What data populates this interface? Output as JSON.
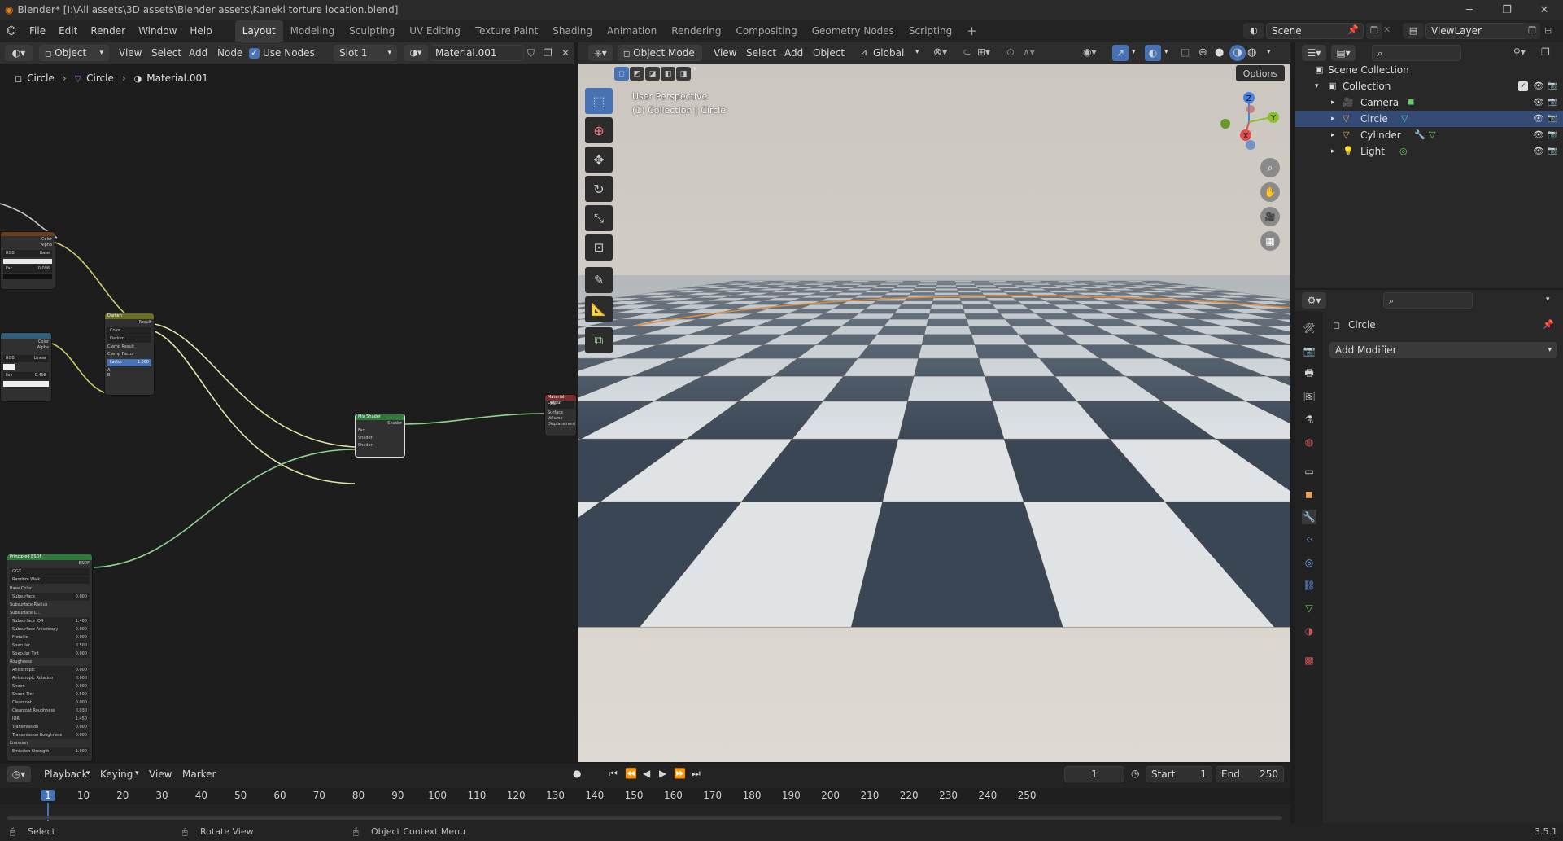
{
  "window": {
    "title": "Blender* [I:\\All assets\\3D assets\\Blender assets\\Kaneki torture location.blend]",
    "minimize": "─",
    "maximize": "❐",
    "close": "✕"
  },
  "menubar": {
    "items": [
      "File",
      "Edit",
      "Render",
      "Window",
      "Help"
    ],
    "workspaces": [
      "Layout",
      "Modeling",
      "Sculpting",
      "UV Editing",
      "Texture Paint",
      "Shading",
      "Animation",
      "Rendering",
      "Compositing",
      "Geometry Nodes",
      "Scripting"
    ],
    "active_workspace": "Layout",
    "add_workspace": "+",
    "scene": "Scene",
    "view_layer": "ViewLayer"
  },
  "node_editor": {
    "object_selector": "Object",
    "menus": [
      "View",
      "Select",
      "Add",
      "Node"
    ],
    "use_nodes_label": "Use Nodes",
    "slot": "Slot 1",
    "material": "Material.001",
    "breadcrumb": [
      "Circle",
      "Circle",
      "Material.001"
    ],
    "nodes": {
      "image1": {
        "color_out": "Color",
        "alpha_out": "Alpha",
        "mode1": "RGB",
        "mode2": "Base",
        "field1": "Fac",
        "field1_val": "0.098"
      },
      "image2": {
        "color_out": "Color",
        "alpha_out": "Alpha",
        "mode1": "RGB",
        "mode2": "Linear",
        "field1": "Fac",
        "field1_val": "0.498"
      },
      "darken": {
        "title": "Darken",
        "out": "Result",
        "opt1": "Color",
        "opt2": "Darken",
        "clamp1": "Clamp Result",
        "clamp2": "Clamp Factor",
        "factor": "Factor",
        "factor_val": "1.000",
        "in_a": "A",
        "in_b": "B"
      },
      "mix_shader": {
        "title": "Mix Shader",
        "out": "Shader",
        "fac": "Fac",
        "sh1": "Shader",
        "sh2": "Shader"
      },
      "material_output": {
        "title": "Material Output",
        "opt": "All",
        "surface": "Surface",
        "volume": "Volume",
        "displacement": "Displacement"
      },
      "principled": {
        "title": "Principled BSDF",
        "out": "BSDF",
        "dist": "GGX",
        "sss": "Random Walk",
        "rows": [
          [
            "Base Color",
            ""
          ],
          [
            "Subsurface",
            "0.000"
          ],
          [
            "Subsurface Radius",
            ""
          ],
          [
            "Subsurface C...",
            ""
          ],
          [
            "Subsurface IOR",
            "1.400"
          ],
          [
            "Subsurface Anisotropy",
            "0.000"
          ],
          [
            "Metallic",
            "0.000"
          ],
          [
            "Specular",
            "0.500"
          ],
          [
            "Specular Tint",
            "0.000"
          ],
          [
            "Roughness",
            ""
          ],
          [
            "Anisotropic",
            "0.000"
          ],
          [
            "Anisotropic Rotation",
            "0.000"
          ],
          [
            "Sheen",
            "0.000"
          ],
          [
            "Sheen Tint",
            "0.500"
          ],
          [
            "Clearcoat",
            "0.000"
          ],
          [
            "Clearcoat Roughness",
            "0.030"
          ],
          [
            "IOR",
            "1.450"
          ],
          [
            "Transmission",
            "0.000"
          ],
          [
            "Transmission Roughness",
            "0.000"
          ],
          [
            "Emission",
            ""
          ],
          [
            "Emission Strength",
            "1.000"
          ]
        ]
      }
    }
  },
  "viewport": {
    "mode": "Object Mode",
    "menus": [
      "View",
      "Select",
      "Add",
      "Object"
    ],
    "orientation": "Global",
    "options": "Options",
    "perspective": "User Perspective",
    "collection_info": "(1) Collection | Circle",
    "gizmo": {
      "z": "Z",
      "y": "Y",
      "x": "X"
    },
    "colors": {
      "sky": "#d2d0c9",
      "floor_dark": "#3a4654",
      "floor_light": "#dfe3e6",
      "horizon": "#d9812e"
    }
  },
  "outliner": {
    "search_placeholder": "",
    "root": "Scene Collection",
    "collection": "Collection",
    "items": [
      "Camera",
      "Circle",
      "Cylinder",
      "Light"
    ],
    "selected": "Circle"
  },
  "properties": {
    "object_name": "Circle",
    "add_modifier": "Add Modifier"
  },
  "timeline": {
    "menus": [
      "Playback",
      "Keying",
      "View",
      "Marker"
    ],
    "current_frame": "1",
    "start_label": "Start",
    "start": "1",
    "end_label": "End",
    "end": "250",
    "ticks": [
      "1",
      "10",
      "20",
      "30",
      "40",
      "50",
      "60",
      "70",
      "80",
      "90",
      "100",
      "110",
      "120",
      "130",
      "140",
      "150",
      "160",
      "170",
      "180",
      "190",
      "200",
      "210",
      "220",
      "230",
      "240",
      "250"
    ]
  },
  "statusbar": {
    "select": "Select",
    "rotate": "Rotate View",
    "context": "Object Context Menu",
    "version": "3.5.1"
  }
}
